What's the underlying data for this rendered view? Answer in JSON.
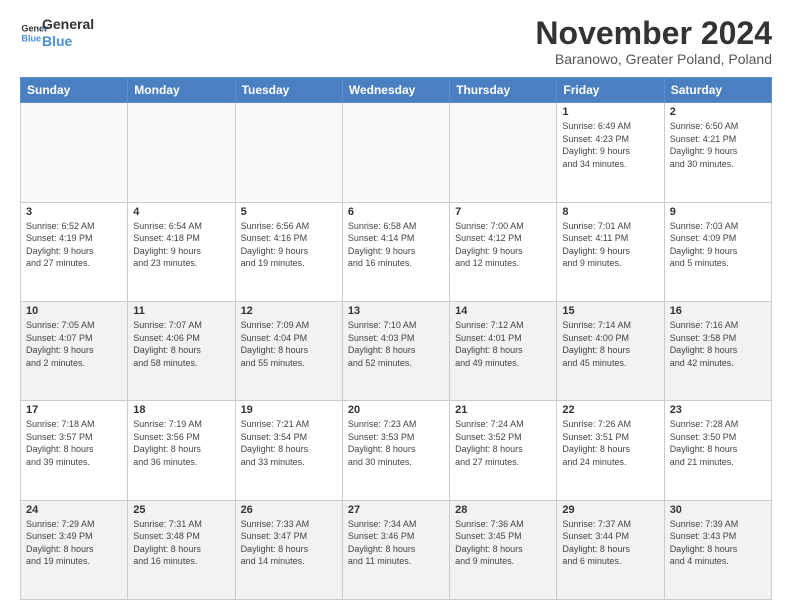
{
  "logo": {
    "line1": "General",
    "line2": "Blue"
  },
  "title": "November 2024",
  "subtitle": "Baranowo, Greater Poland, Poland",
  "header_days": [
    "Sunday",
    "Monday",
    "Tuesday",
    "Wednesday",
    "Thursday",
    "Friday",
    "Saturday"
  ],
  "weeks": [
    [
      {
        "day": "",
        "text": "",
        "empty": true
      },
      {
        "day": "",
        "text": "",
        "empty": true
      },
      {
        "day": "",
        "text": "",
        "empty": true
      },
      {
        "day": "",
        "text": "",
        "empty": true
      },
      {
        "day": "",
        "text": "",
        "empty": true
      },
      {
        "day": "1",
        "text": "Sunrise: 6:49 AM\nSunset: 4:23 PM\nDaylight: 9 hours\nand 34 minutes.",
        "empty": false
      },
      {
        "day": "2",
        "text": "Sunrise: 6:50 AM\nSunset: 4:21 PM\nDaylight: 9 hours\nand 30 minutes.",
        "empty": false
      }
    ],
    [
      {
        "day": "3",
        "text": "Sunrise: 6:52 AM\nSunset: 4:19 PM\nDaylight: 9 hours\nand 27 minutes.",
        "empty": false
      },
      {
        "day": "4",
        "text": "Sunrise: 6:54 AM\nSunset: 4:18 PM\nDaylight: 9 hours\nand 23 minutes.",
        "empty": false
      },
      {
        "day": "5",
        "text": "Sunrise: 6:56 AM\nSunset: 4:16 PM\nDaylight: 9 hours\nand 19 minutes.",
        "empty": false
      },
      {
        "day": "6",
        "text": "Sunrise: 6:58 AM\nSunset: 4:14 PM\nDaylight: 9 hours\nand 16 minutes.",
        "empty": false
      },
      {
        "day": "7",
        "text": "Sunrise: 7:00 AM\nSunset: 4:12 PM\nDaylight: 9 hours\nand 12 minutes.",
        "empty": false
      },
      {
        "day": "8",
        "text": "Sunrise: 7:01 AM\nSunset: 4:11 PM\nDaylight: 9 hours\nand 9 minutes.",
        "empty": false
      },
      {
        "day": "9",
        "text": "Sunrise: 7:03 AM\nSunset: 4:09 PM\nDaylight: 9 hours\nand 5 minutes.",
        "empty": false
      }
    ],
    [
      {
        "day": "10",
        "text": "Sunrise: 7:05 AM\nSunset: 4:07 PM\nDaylight: 9 hours\nand 2 minutes.",
        "empty": false
      },
      {
        "day": "11",
        "text": "Sunrise: 7:07 AM\nSunset: 4:06 PM\nDaylight: 8 hours\nand 58 minutes.",
        "empty": false
      },
      {
        "day": "12",
        "text": "Sunrise: 7:09 AM\nSunset: 4:04 PM\nDaylight: 8 hours\nand 55 minutes.",
        "empty": false
      },
      {
        "day": "13",
        "text": "Sunrise: 7:10 AM\nSunset: 4:03 PM\nDaylight: 8 hours\nand 52 minutes.",
        "empty": false
      },
      {
        "day": "14",
        "text": "Sunrise: 7:12 AM\nSunset: 4:01 PM\nDaylight: 8 hours\nand 49 minutes.",
        "empty": false
      },
      {
        "day": "15",
        "text": "Sunrise: 7:14 AM\nSunset: 4:00 PM\nDaylight: 8 hours\nand 45 minutes.",
        "empty": false
      },
      {
        "day": "16",
        "text": "Sunrise: 7:16 AM\nSunset: 3:58 PM\nDaylight: 8 hours\nand 42 minutes.",
        "empty": false
      }
    ],
    [
      {
        "day": "17",
        "text": "Sunrise: 7:18 AM\nSunset: 3:57 PM\nDaylight: 8 hours\nand 39 minutes.",
        "empty": false
      },
      {
        "day": "18",
        "text": "Sunrise: 7:19 AM\nSunset: 3:56 PM\nDaylight: 8 hours\nand 36 minutes.",
        "empty": false
      },
      {
        "day": "19",
        "text": "Sunrise: 7:21 AM\nSunset: 3:54 PM\nDaylight: 8 hours\nand 33 minutes.",
        "empty": false
      },
      {
        "day": "20",
        "text": "Sunrise: 7:23 AM\nSunset: 3:53 PM\nDaylight: 8 hours\nand 30 minutes.",
        "empty": false
      },
      {
        "day": "21",
        "text": "Sunrise: 7:24 AM\nSunset: 3:52 PM\nDaylight: 8 hours\nand 27 minutes.",
        "empty": false
      },
      {
        "day": "22",
        "text": "Sunrise: 7:26 AM\nSunset: 3:51 PM\nDaylight: 8 hours\nand 24 minutes.",
        "empty": false
      },
      {
        "day": "23",
        "text": "Sunrise: 7:28 AM\nSunset: 3:50 PM\nDaylight: 8 hours\nand 21 minutes.",
        "empty": false
      }
    ],
    [
      {
        "day": "24",
        "text": "Sunrise: 7:29 AM\nSunset: 3:49 PM\nDaylight: 8 hours\nand 19 minutes.",
        "empty": false
      },
      {
        "day": "25",
        "text": "Sunrise: 7:31 AM\nSunset: 3:48 PM\nDaylight: 8 hours\nand 16 minutes.",
        "empty": false
      },
      {
        "day": "26",
        "text": "Sunrise: 7:33 AM\nSunset: 3:47 PM\nDaylight: 8 hours\nand 14 minutes.",
        "empty": false
      },
      {
        "day": "27",
        "text": "Sunrise: 7:34 AM\nSunset: 3:46 PM\nDaylight: 8 hours\nand 11 minutes.",
        "empty": false
      },
      {
        "day": "28",
        "text": "Sunrise: 7:36 AM\nSunset: 3:45 PM\nDaylight: 8 hours\nand 9 minutes.",
        "empty": false
      },
      {
        "day": "29",
        "text": "Sunrise: 7:37 AM\nSunset: 3:44 PM\nDaylight: 8 hours\nand 6 minutes.",
        "empty": false
      },
      {
        "day": "30",
        "text": "Sunrise: 7:39 AM\nSunset: 3:43 PM\nDaylight: 8 hours\nand 4 minutes.",
        "empty": false
      }
    ]
  ]
}
